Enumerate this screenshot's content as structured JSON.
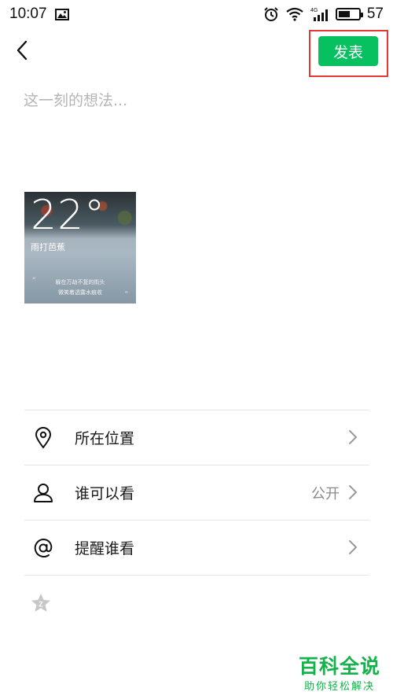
{
  "status_bar": {
    "time": "10:07",
    "battery_text": "57",
    "battery_percent": 57,
    "icons": [
      "image-icon",
      "alarm-icon",
      "wifi-icon",
      "signal-icon",
      "battery-icon"
    ]
  },
  "top_bar": {
    "back_icon": "chevron-left-icon",
    "publish_label": "发表",
    "publish_color": "#07c160",
    "highlight_color": "#e53935"
  },
  "composer": {
    "placeholder": "这一刻的想法...",
    "value": ""
  },
  "photo": {
    "temperature": "22°",
    "subtitle": "雨打芭蕉",
    "quote_line1": "躲在万劫不复的街头",
    "quote_line2": "微笑着透露水痕收",
    "quote_open": "“",
    "quote_close": "”"
  },
  "options": [
    {
      "label": "所在位置",
      "icon": "location-pin-icon",
      "value": ""
    },
    {
      "label": "谁可以看",
      "icon": "person-icon",
      "value": "公开"
    },
    {
      "label": "提醒谁看",
      "icon": "at-icon",
      "value": ""
    }
  ],
  "extra_icon": "star-icon",
  "watermark": {
    "title": "百科全说",
    "subtitle": "助你轻松解决",
    "color": "#13b24a"
  }
}
